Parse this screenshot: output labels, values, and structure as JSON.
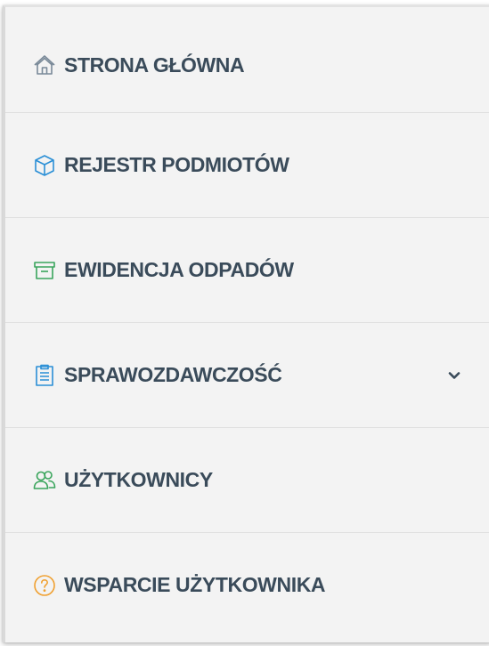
{
  "nav": {
    "items": [
      {
        "label": "STRONA GŁÓWNA",
        "icon": "home-icon",
        "color": "#7a8a99"
      },
      {
        "label": "REJESTR PODMIOTÓW",
        "icon": "cube-icon",
        "color": "#2a8fd6"
      },
      {
        "label": "EWIDENCJA ODPADÓW",
        "icon": "archive-box-icon",
        "color": "#3aa55c"
      },
      {
        "label": "SPRAWOZDAWCZOŚĆ",
        "icon": "clipboard-icon",
        "color": "#2a8fd6",
        "expandable": true
      },
      {
        "label": "UŻYTKOWNICY",
        "icon": "users-icon",
        "color": "#3aa55c"
      },
      {
        "label": "WSPARCIE UŻYTKOWNIKA",
        "icon": "help-circle-icon",
        "color": "#f0a030"
      }
    ]
  },
  "colors": {
    "label_text": "#3a4b5a",
    "background": "#f3f3f3",
    "divider": "#e0e0e0"
  }
}
